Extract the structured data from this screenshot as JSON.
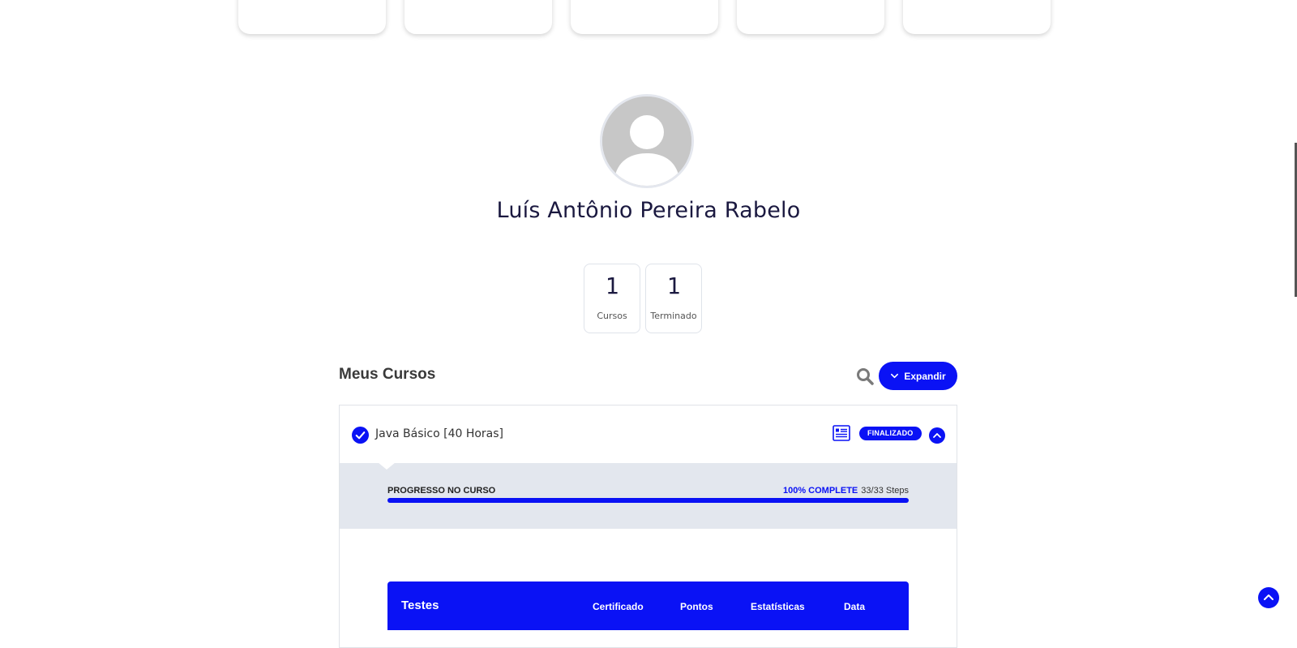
{
  "profile": {
    "name": "Luís Antônio Pereira Rabelo",
    "stats": [
      {
        "value": "1",
        "label": "Cursos"
      },
      {
        "value": "1",
        "label": "Terminado"
      }
    ]
  },
  "courses": {
    "section_title": "Meus Cursos",
    "expand_label": "Expandir",
    "items": [
      {
        "title": "Java Básico [40 Horas]",
        "status": "FINALIZADO",
        "progress_label": "PROGRESSO NO CURSO",
        "progress_percent_label": "100% COMPLETE",
        "progress_steps": "33/33 Steps",
        "progress_fraction": 1.0
      }
    ],
    "quiz_table": {
      "title": "Testes",
      "columns": [
        "Certificado",
        "Pontos",
        "Estatísticas",
        "Data"
      ]
    }
  },
  "colors": {
    "accent": "#0a12f5",
    "progress_bg": "#e3e7ee",
    "text_dark": "#1b1940"
  },
  "icons": {
    "search": "search-icon",
    "expand": "chevron-down-icon",
    "completed": "check-circle-icon",
    "certificate": "certificate-icon",
    "collapse": "chevron-up-icon",
    "back_to_top": "arrow-up-icon"
  }
}
